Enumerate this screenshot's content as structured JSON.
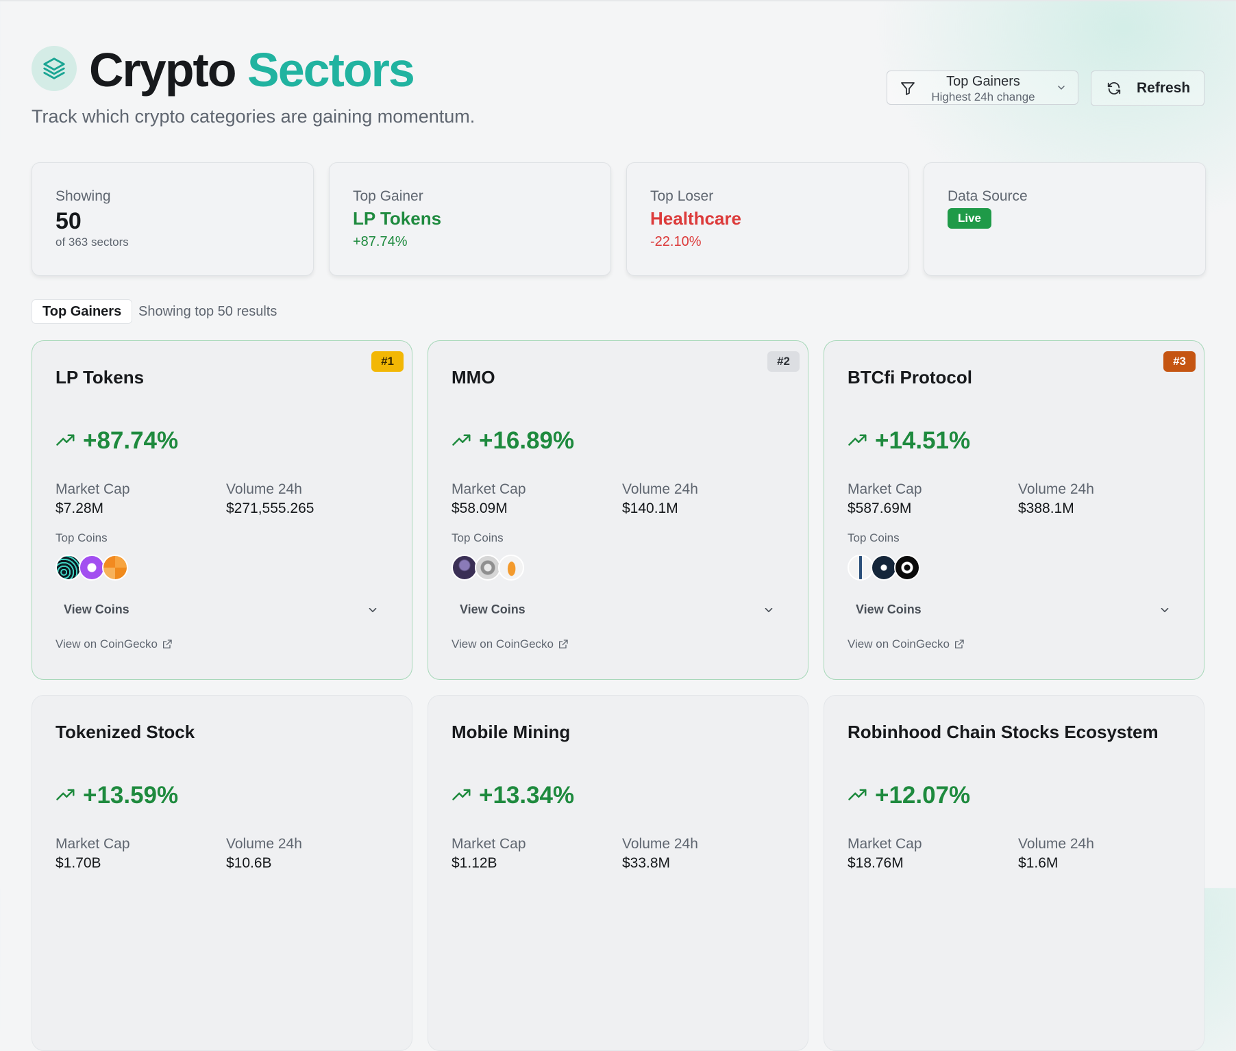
{
  "header": {
    "title_part1": "Crypto",
    "title_part2": "Sectors",
    "subtitle": "Track which crypto categories are gaining momentum."
  },
  "controls": {
    "filter_label": "Top Gainers",
    "filter_sub": "Highest 24h change",
    "refresh_label": "Refresh"
  },
  "stats": {
    "showing_label": "Showing",
    "showing_value": "50",
    "showing_sub": "of 363 sectors",
    "gainer_label": "Top Gainer",
    "gainer_name": "LP Tokens",
    "gainer_pct": "+87.74%",
    "loser_label": "Top Loser",
    "loser_name": "Healthcare",
    "loser_pct": "-22.10%",
    "source_label": "Data Source",
    "source_badge": "Live"
  },
  "tabs": {
    "active": "Top Gainers",
    "info": "Showing top 50 results"
  },
  "labels": {
    "market_cap": "Market Cap",
    "volume": "Volume 24h",
    "top_coins": "Top Coins",
    "view_coins": "View Coins",
    "coingecko": "View on CoinGecko"
  },
  "cards": [
    {
      "name": "LP Tokens",
      "rank": "#1",
      "change": "+87.74%",
      "market_cap": "$7.28M",
      "volume": "$271,555.265"
    },
    {
      "name": "MMO",
      "rank": "#2",
      "change": "+16.89%",
      "market_cap": "$58.09M",
      "volume": "$140.1M"
    },
    {
      "name": "BTCfi Protocol",
      "rank": "#3",
      "change": "+14.51%",
      "market_cap": "$587.69M",
      "volume": "$388.1M"
    },
    {
      "name": "Tokenized Stock",
      "change": "+13.59%",
      "market_cap": "$1.70B",
      "volume": "$10.6B"
    },
    {
      "name": "Mobile Mining",
      "change": "+13.34%",
      "market_cap": "$1.12B",
      "volume": "$33.8M"
    },
    {
      "name": "Robinhood Chain Stocks Ecosystem",
      "change": "+12.07%",
      "market_cap": "$18.76M",
      "volume": "$1.6M"
    }
  ],
  "colors": {
    "accent": "#21b3a0",
    "positive": "#1e8a3e",
    "negative": "#dc3a3a",
    "live": "#1f9a48",
    "rank1": "#f2b705",
    "rank2": "#dcdee2",
    "rank3": "#c55512"
  }
}
